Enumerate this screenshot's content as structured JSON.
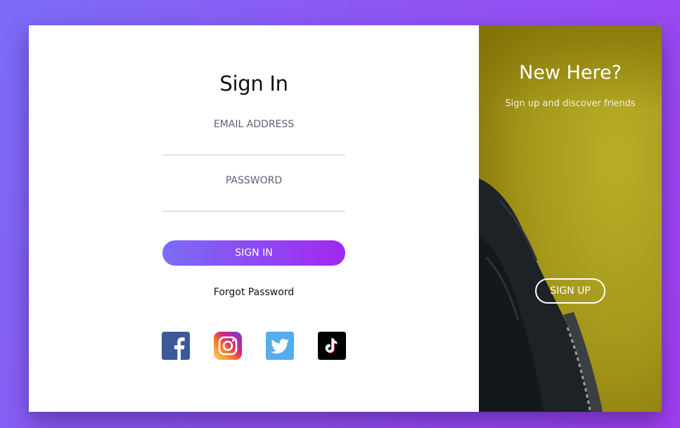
{
  "signin": {
    "title": "Sign In",
    "email_label": "EMAIL ADDRESS",
    "email_value": "",
    "password_label": "PASSWORD",
    "password_value": "",
    "submit_label": "SIGN IN",
    "forgot_label": "Forgot Password"
  },
  "social": [
    {
      "name": "facebook-icon",
      "color": "#3b5998"
    },
    {
      "name": "instagram-icon",
      "color": "#e1306c"
    },
    {
      "name": "twitter-icon",
      "color": "#55acee"
    },
    {
      "name": "tiktok-icon",
      "color": "#000000"
    }
  ],
  "promo": {
    "title": "New Here?",
    "subtitle": "Sign up and discover friends",
    "signup_label": "SIGN UP"
  },
  "colors": {
    "accent_start": "#7a6df6",
    "accent_end": "#a228f0",
    "promo_bg": "#a79b1c"
  }
}
